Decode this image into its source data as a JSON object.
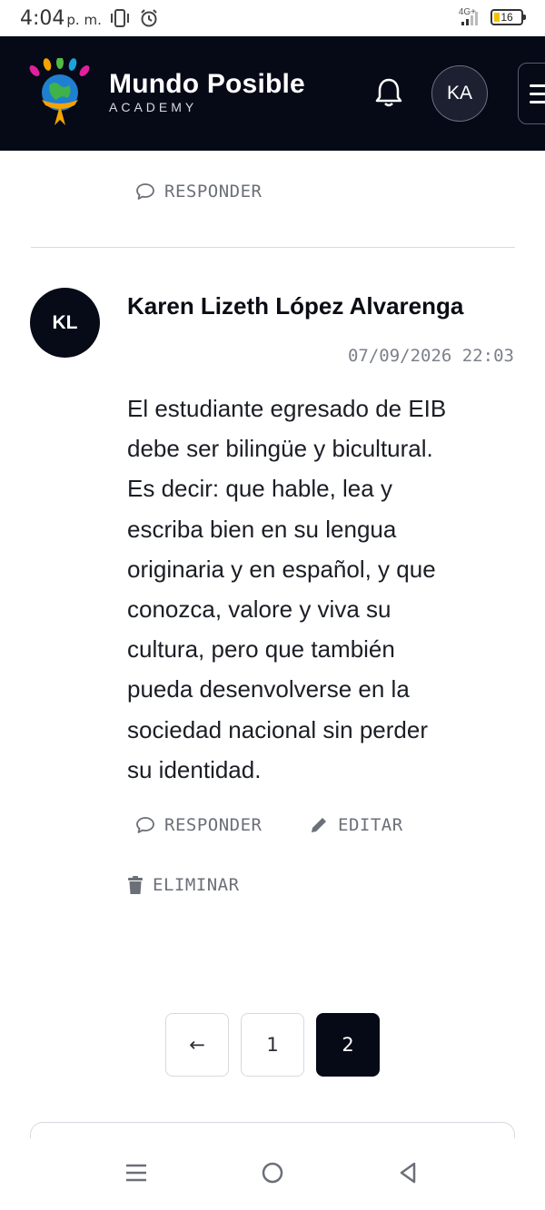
{
  "status_bar": {
    "time": "4:04",
    "period": "p. m.",
    "network": "4G+",
    "battery": "16"
  },
  "header": {
    "brand_title": "Mundo Posible",
    "brand_subtitle": "ACADEMY",
    "user_initials": "KA"
  },
  "previous_comment": {
    "reply_label": "RESPONDER"
  },
  "comment": {
    "author_initials": "KL",
    "author": "Karen Lizeth López Alvarenga",
    "date": "07/09/2026 22:03",
    "lines": [
      "El estudiante egresado de EIB",
      "debe ser bilingüe y bicultural.",
      "Es decir: que hable, lea y",
      "escriba bien en su lengua",
      "originaria y en español, y que",
      "conozca, valore y viva su",
      "cultura, pero que también",
      "pueda desenvolverse en la",
      "sociedad nacional sin perder",
      "su identidad."
    ],
    "reply_label": "RESPONDER",
    "edit_label": "EDITAR",
    "delete_label": "ELIMINAR"
  },
  "pagination": {
    "prev_symbol": "←",
    "pages": [
      "1",
      "2"
    ],
    "current_page": "2"
  },
  "icons": {
    "reply": "chat-bubble-icon",
    "edit": "pencil-icon",
    "delete": "trash-icon",
    "notifications": "bell-icon",
    "menu": "hamburger-icon"
  },
  "colors": {
    "header_bg": "#060916",
    "active_page": "#060916",
    "muted_text": "#6b6f78"
  }
}
